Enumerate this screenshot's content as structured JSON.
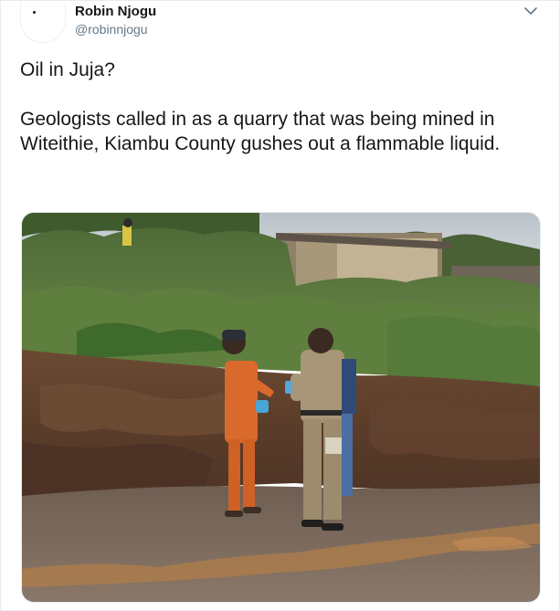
{
  "author": {
    "display_name": "Robin Njogu",
    "handle": "@robinnjogu"
  },
  "tweet": {
    "paragraphs": [
      "Oil in Juja?",
      "Geologists called in as a quarry that was being mined in Witeithie, Kiambu County gushes out a flammable liquid."
    ]
  },
  "icons": {
    "menu": "chevron-down-icon",
    "avatar": "avatar"
  },
  "colors": {
    "text_primary": "#14171a",
    "text_secondary": "#657786",
    "border": "#e6ecf0"
  }
}
